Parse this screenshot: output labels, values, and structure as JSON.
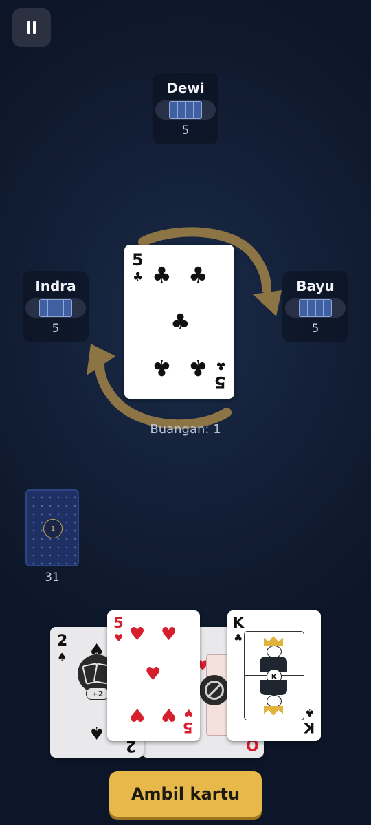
{
  "controls": {
    "pause_icon": "pause-icon"
  },
  "players": {
    "top": {
      "name": "Dewi",
      "count": "5"
    },
    "left": {
      "name": "Indra",
      "count": "5"
    },
    "right": {
      "name": "Bayu",
      "count": "5"
    }
  },
  "discard": {
    "top_card": {
      "rank": "5",
      "suit": "clubs",
      "suit_symbol": "♣",
      "color": "#111111"
    },
    "label": "Buangan: 1"
  },
  "deck": {
    "badge": "1",
    "count": "31"
  },
  "hand": {
    "cards": [
      {
        "rank": "2",
        "suit": "spades",
        "suit_symbol": "♠",
        "color": "#111111",
        "action": "+2",
        "icon": "draw-two-icon"
      },
      {
        "rank": "Q",
        "suit": "hearts",
        "suit_symbol": "♥",
        "color": "#d61f2c",
        "icon": "skip-icon"
      },
      {
        "rank": "5",
        "suit": "hearts",
        "suit_symbol": "♥",
        "color": "#d61f2c"
      },
      {
        "rank": "K",
        "suit": "clubs",
        "suit_symbol": "♣",
        "color": "#111111",
        "icon": "king-icon",
        "center_rank": "K"
      }
    ]
  },
  "actions": {
    "draw_label": "Ambil kartu"
  },
  "colors": {
    "arrow": "#8c7444",
    "button": "#e7b84a",
    "table": "#132038"
  }
}
